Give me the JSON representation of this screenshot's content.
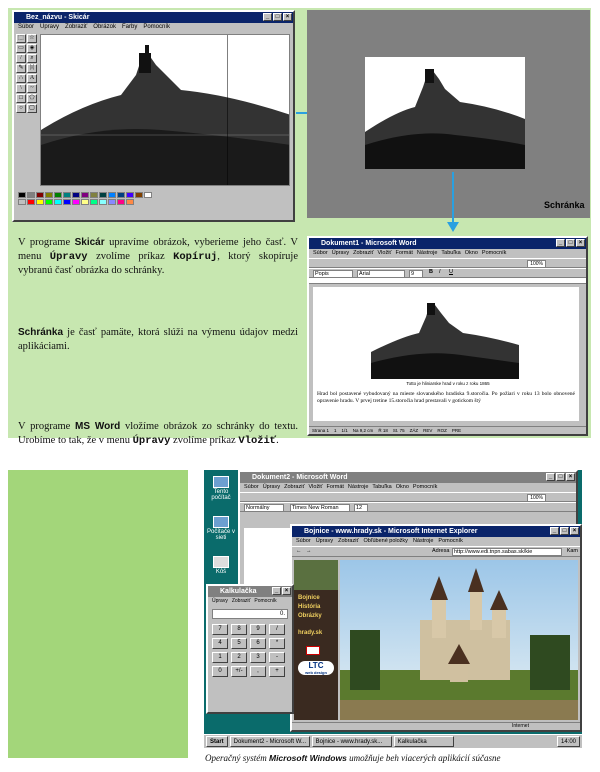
{
  "paint": {
    "title": "Bez_názvu - Skicár",
    "menu": [
      "Súbor",
      "Úpravy",
      "Zobraziť",
      "Obrázok",
      "Farby",
      "Pomocník"
    ]
  },
  "clipboard": {
    "label": "Schránka"
  },
  "word1": {
    "title": "Dokument1 - Microsoft Word",
    "menu": [
      "Súbor",
      "Úpravy",
      "Zobraziť",
      "Vložiť",
      "Formát",
      "Nástroje",
      "Tabuľka",
      "Okno",
      "Pomocník"
    ],
    "style": "Popis",
    "font": "Arial",
    "size": "9",
    "zoom": "100%",
    "image_caption": "Totto je hliniarske hrad v roku z roku 1865",
    "body": "Hrad bol postavené vybudovaný na mieste slovanského hradiska 9.storočia. Po požiari v roku 13 bolo obnovené opravenie hradu. V prvej tretine 15.storočia hrad prestavali v gotickom štý",
    "status": [
      "Strana 1",
      "1",
      "1/1",
      "Na 9,2 cm",
      "Ř 18",
      "St. 75",
      "ZÁZ",
      "REV",
      "ROZ",
      "PRE"
    ]
  },
  "text": {
    "p1": [
      "V programe ",
      "Skicár",
      " upravíme obrázok, vyberieme jeho časť. V menu ",
      "Úpravy",
      " zvolíme príkaz ",
      "Kopíruj",
      ", ktorý skopíruje vybranú časť obrázka do schránky."
    ],
    "p2": [
      "Schránka",
      " je časť pamäte, ktorá slúži na výmenu údajov medzi aplikáciami."
    ],
    "p3": [
      "V programe ",
      "MS Word",
      " vložíme obrázok zo schránky do textu. Urobíme to tak, že v menu ",
      "Úpravy",
      " zvolíme príkaz ",
      "Vložiť",
      "."
    ]
  },
  "desktop": {
    "icons": [
      "Tento počítač",
      "Počítače v sieti",
      "Kôš"
    ],
    "word2": {
      "title": "Dokument2 - Microsoft Word",
      "menu": [
        "Súbor",
        "Úpravy",
        "Zobraziť",
        "Vložiť",
        "Formát",
        "Nástroje",
        "Tabuľka",
        "Okno",
        "Pomocník"
      ],
      "style": "Normálny",
      "font": "Times New Roman",
      "size": "12",
      "zoom": "100%"
    },
    "ie": {
      "title": "Bojnice - www.hrady.sk - Microsoft Internet Explorer",
      "menu": [
        "Súbor",
        "Úpravy",
        "Zobraziť",
        "Obľúbené položky",
        "Nástroje",
        "Pomocník"
      ],
      "address_label": "Adresa",
      "address": "http://www.edi.tnpn.sabas.sk/kie",
      "go": "Kam",
      "nav": [
        "Bojnice",
        "História",
        "Obrázky"
      ],
      "site": "hrady.sk",
      "logo_big": "LTC",
      "logo_small": "web design",
      "status": "Internet"
    },
    "calc": {
      "title": "Kalkulačka",
      "menu": [
        "Úpravy",
        "Zobraziť",
        "Pomocník"
      ],
      "display": "0."
    },
    "taskbar": [
      "Start",
      "Dokument2 - Microsoft W...",
      "Bojnice - www.hrady.sk...",
      "Kalkulačka"
    ],
    "clock": "14:00"
  },
  "caption": [
    "Operačný systém ",
    "Microsoft Windows",
    " umožňuje beh viacerých aplikácií súčasne"
  ]
}
